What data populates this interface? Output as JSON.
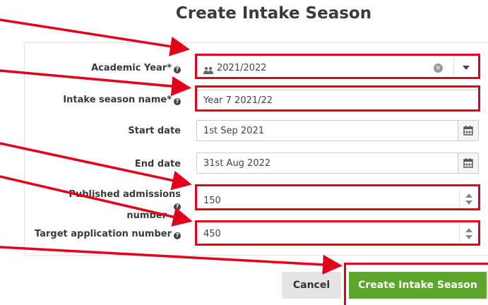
{
  "page": {
    "title": "Create Intake Season"
  },
  "form": {
    "academic_year": {
      "label": "Academic Year*",
      "value": "2021/2022"
    },
    "intake_name": {
      "label": "Intake season name*",
      "value": "Year 7 2021/22"
    },
    "start_date": {
      "label": "Start date",
      "value": "1st Sep 2021"
    },
    "end_date": {
      "label": "End date",
      "value": "31st Aug 2022"
    },
    "published_admissions": {
      "label_line1": "Published admissions",
      "label_line2": "number",
      "value": "150"
    },
    "target_application": {
      "label": "Target application number",
      "value": "450"
    }
  },
  "buttons": {
    "cancel": "Cancel",
    "create": "Create Intake Season"
  },
  "colors": {
    "annotation_red": "#e2001a",
    "primary_green": "#5aa52a"
  },
  "icons": [
    "help-icon",
    "group-icon",
    "clear-icon",
    "dropdown-arrow-icon",
    "calendar-icon",
    "spinner-icon"
  ]
}
